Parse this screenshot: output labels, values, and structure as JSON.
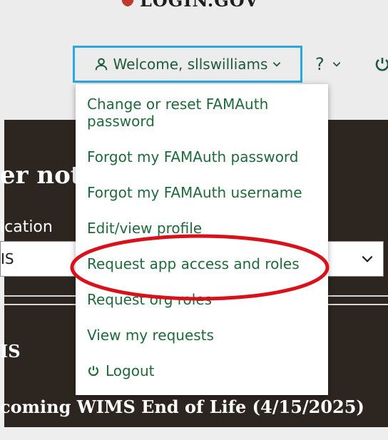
{
  "header": {
    "logo_text": "LOGIN.GOV",
    "welcome_label": "Welcome, sllswilliams",
    "help_label": "?"
  },
  "background": {
    "heading_partial": "er noti",
    "app_label_partial": "ication",
    "select_value_partial": "IS",
    "wims_partial": "IS",
    "upcoming_partial": "coming WIMS End of Life (4/15/2025)"
  },
  "dropdown": {
    "items": [
      {
        "label": "Change or reset FAMAuth password"
      },
      {
        "label": "Forgot my FAMAuth password"
      },
      {
        "label": "Forgot my FAMAuth username"
      },
      {
        "label": "Edit/view profile"
      },
      {
        "label": "Request app access and roles"
      },
      {
        "label": "Request org roles"
      },
      {
        "label": "View my requests"
      }
    ],
    "logout_label": "Logout"
  },
  "colors": {
    "link_green": "#1f6a3a",
    "focus_blue": "#2aa8e0",
    "dark_panel": "#2d2520",
    "annotation_red": "#d8121b"
  },
  "icons": {
    "user": "user-icon",
    "chevron": "chevron-down-icon",
    "power": "power-icon"
  }
}
